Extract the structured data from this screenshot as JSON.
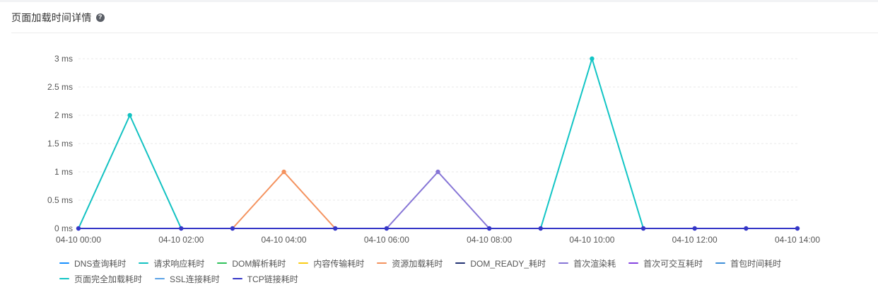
{
  "header": {
    "title": "页面加载时间详情",
    "help_icon": "?"
  },
  "chart_data": {
    "type": "line",
    "x": [
      "04-10 00:00",
      "04-10 01:00",
      "04-10 02:00",
      "04-10 03:00",
      "04-10 04:00",
      "04-10 05:00",
      "04-10 06:00",
      "04-10 07:00",
      "04-10 08:00",
      "04-10 09:00",
      "04-10 10:00",
      "04-10 11:00",
      "04-10 12:00",
      "04-10 13:00",
      "04-10 14:00"
    ],
    "x_tick_labels": [
      "04-10 00:00",
      "04-10 02:00",
      "04-10 04:00",
      "04-10 06:00",
      "04-10 08:00",
      "04-10 10:00",
      "04-10 12:00",
      "04-10 14:00"
    ],
    "y_ticks": [
      0,
      0.5,
      1,
      1.5,
      2,
      2.5,
      3
    ],
    "y_unit": "ms",
    "ylim": [
      0,
      3
    ],
    "grid": true,
    "legend_placement": "bottom",
    "series": [
      {
        "name": "DNS查询耗时",
        "color": "#1890ff",
        "values": [
          0,
          0,
          0,
          0,
          0,
          0,
          0,
          0,
          0,
          0,
          0,
          0,
          0,
          0,
          0
        ]
      },
      {
        "name": "请求响应耗时",
        "color": "#13c2c2",
        "values": [
          0,
          2,
          0,
          0,
          0,
          0,
          0,
          0,
          0,
          0,
          0,
          0,
          0,
          0,
          0
        ]
      },
      {
        "name": "DOM解析耗时",
        "color": "#2fc25b",
        "values": [
          0,
          0,
          0,
          0,
          0,
          0,
          0,
          0,
          0,
          0,
          0,
          0,
          0,
          0,
          0
        ]
      },
      {
        "name": "内容传输耗时",
        "color": "#facc14",
        "values": [
          0,
          0,
          0,
          0,
          0,
          0,
          0,
          0,
          0,
          0,
          0,
          0,
          0,
          0,
          0
        ]
      },
      {
        "name": "资源加载耗时",
        "color": "#f4925e",
        "values": [
          0,
          0,
          0,
          0,
          1,
          0,
          0,
          0,
          0,
          0,
          0,
          0,
          0,
          0,
          0
        ]
      },
      {
        "name": "DOM_READY_耗时",
        "color": "#223273",
        "values": [
          0,
          0,
          0,
          0,
          0,
          0,
          0,
          0,
          0,
          0,
          0,
          0,
          0,
          0,
          0
        ]
      },
      {
        "name": "首次渲染耗",
        "color": "#8675d6",
        "values": [
          0,
          0,
          0,
          0,
          0,
          0,
          0,
          1,
          0,
          0,
          0,
          0,
          0,
          0,
          0
        ]
      },
      {
        "name": "首次可交互耗时",
        "color": "#8543e0",
        "values": [
          0,
          0,
          0,
          0,
          0,
          0,
          0,
          0,
          0,
          0,
          0,
          0,
          0,
          0,
          0
        ]
      },
      {
        "name": "首包时间耗时",
        "color": "#3f8fd9",
        "values": [
          0,
          0,
          0,
          0,
          0,
          0,
          0,
          0,
          0,
          0,
          0,
          0,
          0,
          0,
          0
        ]
      },
      {
        "name": "页面完全加载耗时",
        "color": "#12c5c5",
        "values": [
          0,
          0,
          0,
          0,
          0,
          0,
          0,
          0,
          0,
          0,
          3,
          0,
          0,
          0,
          0
        ]
      },
      {
        "name": "SSL连接耗时",
        "color": "#5aa2e6",
        "values": [
          0,
          0,
          0,
          0,
          0,
          0,
          0,
          0,
          0,
          0,
          0,
          0,
          0,
          0,
          0
        ]
      },
      {
        "name": "TCP链接耗时",
        "color": "#3436c7",
        "values": [
          0,
          0,
          0,
          0,
          0,
          0,
          0,
          0,
          0,
          0,
          0,
          0,
          0,
          0,
          0
        ]
      }
    ]
  }
}
